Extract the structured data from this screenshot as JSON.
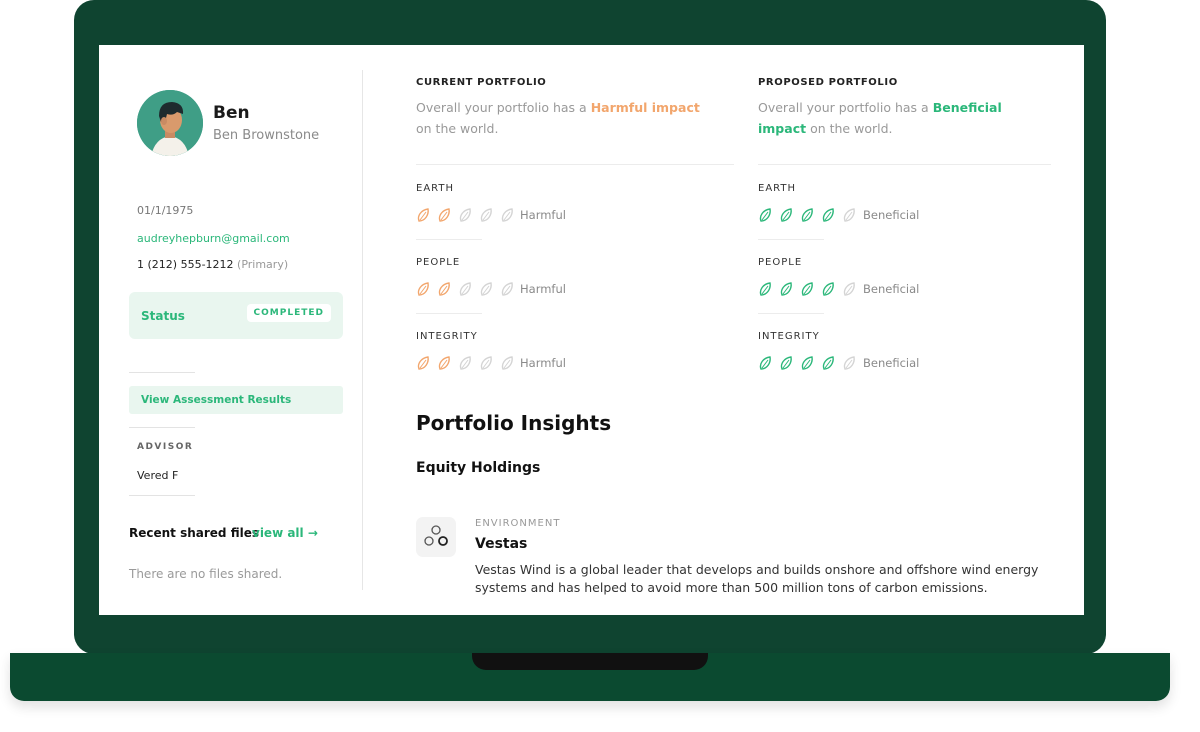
{
  "profile": {
    "name": "Ben",
    "full_name": "Ben Brownstone",
    "dob": "01/1/1975",
    "email": "audreyhepburn@gmail.com",
    "phone": "1 (212) 555-1212",
    "phone_tag": "(Primary)"
  },
  "status": {
    "label": "Status",
    "badge": "COMPLETED"
  },
  "assessment_button": "View Assessment Results",
  "advisor": {
    "heading": "ADVISOR",
    "name": "Vered F"
  },
  "files": {
    "title": "Recent shared files",
    "view_all": "view all →",
    "empty": "There are no files shared."
  },
  "current": {
    "heading": "CURRENT PORTFOLIO",
    "summary_prefix": "Overall your portfolio has a",
    "summary_highlight": "Harmful impact",
    "summary_suffix": "on the world.",
    "categories": [
      {
        "label": "EARTH",
        "rating": 2,
        "text": "Harmful"
      },
      {
        "label": "PEOPLE",
        "rating": 2,
        "text": "Harmful"
      },
      {
        "label": "INTEGRITY",
        "rating": 2,
        "text": "Harmful"
      }
    ]
  },
  "proposed": {
    "heading": "PROPOSED PORTFOLIO",
    "summary_prefix": "Overall your portfolio has a",
    "summary_highlight_1": "Beneficial",
    "summary_highlight_2": "impact",
    "summary_suffix": "on the world.",
    "categories": [
      {
        "label": "EARTH",
        "rating": 4,
        "text": "Beneficial"
      },
      {
        "label": "PEOPLE",
        "rating": 4,
        "text": "Beneficial"
      },
      {
        "label": "INTEGRITY",
        "rating": 4,
        "text": "Beneficial"
      }
    ]
  },
  "rating_max": 5,
  "colors": {
    "harmful": "#f2a66d",
    "beneficial": "#2bb77a",
    "empty": "#d4d4d4",
    "laptop": "#0f4430"
  },
  "icons": {
    "leaf": "leaf-icon",
    "holding": "circles-icon"
  },
  "insights": {
    "title": "Portfolio Insights",
    "subtitle": "Equity Holdings",
    "holding": {
      "category": "ENVIRONMENT",
      "name": "Vestas",
      "description": "Vestas Wind is a global leader that develops and builds onshore and offshore wind energy systems and has helped to avoid more than 500 million tons of carbon emissions."
    }
  }
}
